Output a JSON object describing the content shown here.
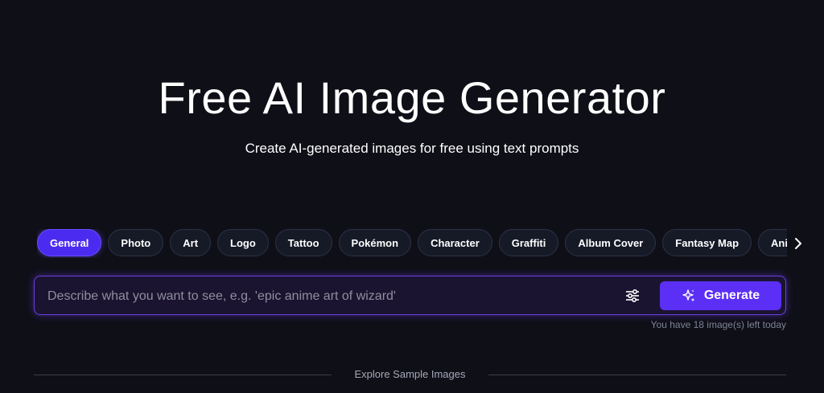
{
  "hero": {
    "title": "Free AI Image Generator",
    "subtitle": "Create AI-generated images for free using text prompts"
  },
  "categories": {
    "active_index": 0,
    "items": [
      "General",
      "Photo",
      "Art",
      "Logo",
      "Tattoo",
      "Pokémon",
      "Character",
      "Graffiti",
      "Album Cover",
      "Fantasy Map",
      "Anime"
    ],
    "next_icon": "chevron-right-icon"
  },
  "prompt": {
    "placeholder": "Describe what you want to see, e.g. 'epic anime art of wizard'",
    "value": "",
    "settings_icon": "sliders-icon",
    "generate_icon": "sparkles-icon",
    "generate_label": "Generate",
    "quota_text": "You have 18 image(s) left today"
  },
  "explore": {
    "label": "Explore Sample Images"
  },
  "colors": {
    "background": "#0f0f17",
    "accent": "#5b2ff5",
    "chip_active": "#4b2bf0",
    "chip_bg": "#161a27",
    "prompt_border": "#6a3fe0",
    "muted_text": "#7d8498"
  }
}
